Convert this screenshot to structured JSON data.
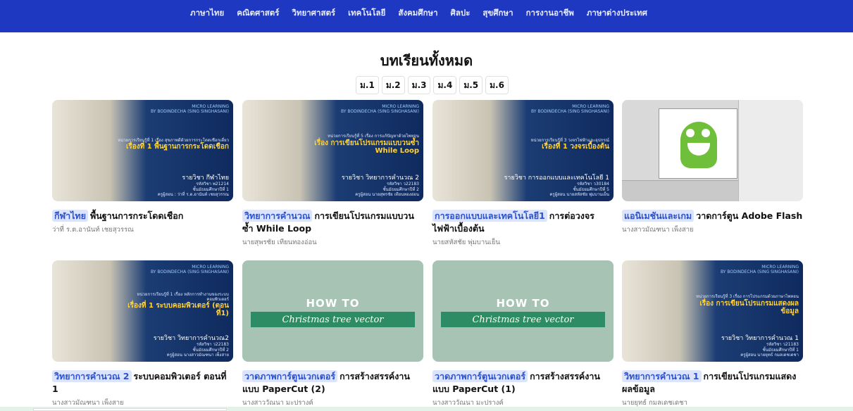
{
  "nav": {
    "items": [
      "ภาษาไทย",
      "คณิตศาสตร์",
      "วิทยาศาสตร์",
      "เทคโนโลยี",
      "สังคมศึกษา",
      "ศิลปะ",
      "สุขศึกษา",
      "การงานอาชีพ",
      "ภาษาต่างประเทศ"
    ]
  },
  "page": {
    "title": "บทเรียนทั้งหมด"
  },
  "grades": [
    "ม.1",
    "ม.2",
    "ม.3",
    "ม.4",
    "ม.5",
    "ม.6"
  ],
  "colors": {
    "nav_bg": "#1f38c2",
    "tag_bg": "#dbe4fb",
    "tag_text": "#2d51c9"
  },
  "cards": [
    {
      "tag": "กีฬาไทย",
      "title": "พื้นฐานการกระโดดเชือก",
      "author": "ว่าที่ ร.ต.อานันท์ เชยสุวรรณ",
      "thumb": {
        "type": "photo",
        "brand": "MICRO LEARNING",
        "by": "BY BODINDECHA (SING SINGHASANI)",
        "unit": "หน่วยการเรียนรู้ที่ 1 เรื่อง สุขภาพดีด้วยการกระโดดเชือกเดี่ยว",
        "headline": "เรื่องที่ 1 พื้นฐานการกระโดดเชือก",
        "subject": "รายวิชา กีฬาไทย",
        "code": "รหัสวิชา พ21214",
        "level": "ชั้นมัธยมศึกษาปีที่ 1",
        "teacher": "ครูผู้สอน : ว่าที่ ร.ต.อานันท์ เชยสุวรรณ"
      }
    },
    {
      "tag": "วิทยาการคำนวณ",
      "title": "การเขียนโปรแกรมแบบวนซ้ำ While Loop",
      "author": "นายสุพรชัย เทียนทองอ่อน",
      "thumb": {
        "type": "photo",
        "brand": "MICRO LEARNING",
        "by": "BY BODINDECHA (SING SINGHASANI)",
        "unit": "หน่วยการเรียนรู้ที่ 5 เรื่อง การแก้ปัญหาด้วยไพทอน",
        "headline": "เรื่อง การเขียนโปรแกรมแบบวนซ้ำ While Loop",
        "subject": "รายวิชา วิทยาการคำนวณ 2",
        "code": "รหัสวิชา ว22183",
        "level": "ชั้นมัธยมศึกษาปีที่ 2",
        "teacher": "ครูผู้สอน นายสุพรชัย เทียนทองอ่อน"
      }
    },
    {
      "tag": "การออกแบบและเทคโนโลยี1",
      "title": "การต่อวงจรไฟฟ้าเบื้องต้น",
      "author": "นายสหัสชัย พุ่มบานเย็น",
      "thumb": {
        "type": "photo",
        "brand": "MICRO LEARNING",
        "by": "BY BODINDECHA (SING SINGHASANI)",
        "unit": "หน่วยการเรียนรู้ที่ 3 วงจรไฟฟ้าและอุปกรณ์",
        "headline": "เรื่องที่ 1 วงจรเบื้องต้น",
        "subject": "รายวิชา การออกแบบและเทคโนโลยี 1",
        "code": "รหัสวิชา ว30184",
        "level": "ชั้นมัธยมศึกษาปีที่ 5",
        "teacher": "ครูผู้สอน นายสหัสชัย พุ่มบานเย็น"
      }
    },
    {
      "tag": "แอนิเมชันและเกม",
      "title": "วาดการ์ตูน Adobe Flash",
      "author": "นางสาวมัณฑนา เพ็งสาย",
      "thumb": {
        "type": "flash"
      }
    },
    {
      "tag": "วิทยาการคำนวณ 2",
      "title": "ระบบคอมพิวเตอร์ ตอนที่ 1",
      "author": "นางสาวมัณฑนา เพ็งสาย",
      "thumb": {
        "type": "photo",
        "brand": "MICRO LEARNING",
        "by": "BY BODINDECHA (SING SINGHASANI)",
        "unit": "หน่วยการเรียนรู้ที่ 1 เรื่อง หลักการทำงานของระบบคอมพิวเตอร์",
        "headline": "เรื่องที่ 1 ระบบคอมพิวเตอร์ (ตอนที่1)",
        "subject": "รายวิชา วิทยาการคำนวณ2",
        "code": "รหัสวิชา ว22183",
        "level": "ชั้นมัธยมศึกษาปีที่ 2",
        "teacher": "ครูผู้สอน นางสาวมัณฑนา เพ็งสาย"
      }
    },
    {
      "tag": "วาดภาพการ์ตูนเวกเตอร์",
      "title": "การสร้างสรรค์งานแบบ PaperCut (2)",
      "author": "นางสาววัณนา มะปรางค์",
      "thumb": {
        "type": "green",
        "howto": "HOW TO",
        "ctv": "Christmas tree vector"
      }
    },
    {
      "tag": "วาดภาพการ์ตูนเวกเตอร์",
      "title": "การสร้างสรรค์งานแบบ PaperCut (1)",
      "author": "นางสาววัณนา มะปรางค์",
      "thumb": {
        "type": "green",
        "howto": "HOW TO",
        "ctv": "Christmas tree vector"
      }
    },
    {
      "tag": "วิทยาการคำนวณ 1",
      "title": "การเขียนโปรแกรมแสดงผลข้อมูล",
      "author": "นายยุทธ์ กมลเดชเดชา",
      "thumb": {
        "type": "photo",
        "brand": "MICRO LEARNING",
        "by": "BY BODINDECHA (SING SINGHASANI)",
        "unit": "หน่วยการเรียนรู้ที่ 3 เรื่อง การโปรแกรมด้วยภาษาไพทอน",
        "headline": "เรื่อง การเขียนโปรแกรมแสดงผลข้อมูล",
        "subject": "รายวิชา วิทยาการคำนวณ 1",
        "code": "รหัสวิชา ว21183",
        "level": "ชั้นมัธยมศึกษาปีที่ 1",
        "teacher": "ครูผู้สอน นายยุทธ์ กมลเดชเดชา"
      }
    }
  ]
}
